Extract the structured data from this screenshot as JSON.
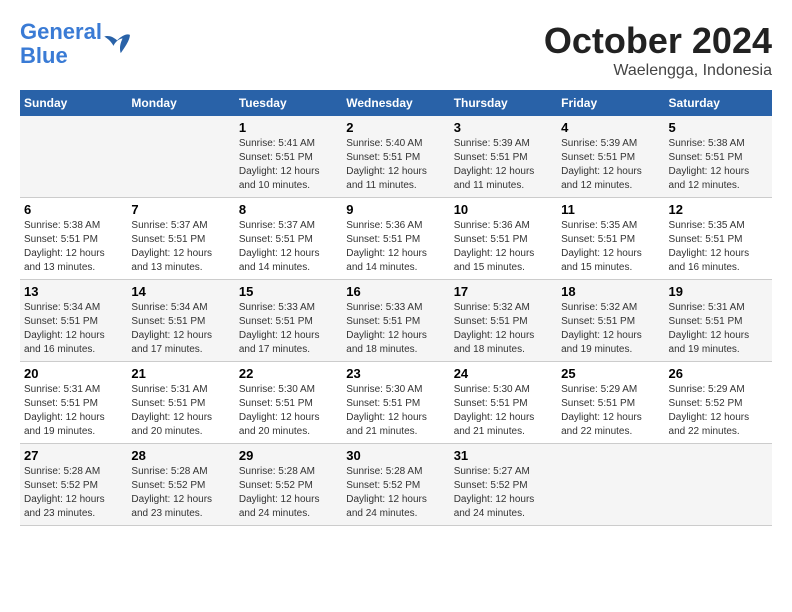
{
  "logo": {
    "line1": "General",
    "line2": "Blue"
  },
  "title": "October 2024",
  "subtitle": "Waelengga, Indonesia",
  "weekdays": [
    "Sunday",
    "Monday",
    "Tuesday",
    "Wednesday",
    "Thursday",
    "Friday",
    "Saturday"
  ],
  "weeks": [
    [
      {
        "day": "",
        "info": ""
      },
      {
        "day": "",
        "info": ""
      },
      {
        "day": "1",
        "info": "Sunrise: 5:41 AM\nSunset: 5:51 PM\nDaylight: 12 hours\nand 10 minutes."
      },
      {
        "day": "2",
        "info": "Sunrise: 5:40 AM\nSunset: 5:51 PM\nDaylight: 12 hours\nand 11 minutes."
      },
      {
        "day": "3",
        "info": "Sunrise: 5:39 AM\nSunset: 5:51 PM\nDaylight: 12 hours\nand 11 minutes."
      },
      {
        "day": "4",
        "info": "Sunrise: 5:39 AM\nSunset: 5:51 PM\nDaylight: 12 hours\nand 12 minutes."
      },
      {
        "day": "5",
        "info": "Sunrise: 5:38 AM\nSunset: 5:51 PM\nDaylight: 12 hours\nand 12 minutes."
      }
    ],
    [
      {
        "day": "6",
        "info": "Sunrise: 5:38 AM\nSunset: 5:51 PM\nDaylight: 12 hours\nand 13 minutes."
      },
      {
        "day": "7",
        "info": "Sunrise: 5:37 AM\nSunset: 5:51 PM\nDaylight: 12 hours\nand 13 minutes."
      },
      {
        "day": "8",
        "info": "Sunrise: 5:37 AM\nSunset: 5:51 PM\nDaylight: 12 hours\nand 14 minutes."
      },
      {
        "day": "9",
        "info": "Sunrise: 5:36 AM\nSunset: 5:51 PM\nDaylight: 12 hours\nand 14 minutes."
      },
      {
        "day": "10",
        "info": "Sunrise: 5:36 AM\nSunset: 5:51 PM\nDaylight: 12 hours\nand 15 minutes."
      },
      {
        "day": "11",
        "info": "Sunrise: 5:35 AM\nSunset: 5:51 PM\nDaylight: 12 hours\nand 15 minutes."
      },
      {
        "day": "12",
        "info": "Sunrise: 5:35 AM\nSunset: 5:51 PM\nDaylight: 12 hours\nand 16 minutes."
      }
    ],
    [
      {
        "day": "13",
        "info": "Sunrise: 5:34 AM\nSunset: 5:51 PM\nDaylight: 12 hours\nand 16 minutes."
      },
      {
        "day": "14",
        "info": "Sunrise: 5:34 AM\nSunset: 5:51 PM\nDaylight: 12 hours\nand 17 minutes."
      },
      {
        "day": "15",
        "info": "Sunrise: 5:33 AM\nSunset: 5:51 PM\nDaylight: 12 hours\nand 17 minutes."
      },
      {
        "day": "16",
        "info": "Sunrise: 5:33 AM\nSunset: 5:51 PM\nDaylight: 12 hours\nand 18 minutes."
      },
      {
        "day": "17",
        "info": "Sunrise: 5:32 AM\nSunset: 5:51 PM\nDaylight: 12 hours\nand 18 minutes."
      },
      {
        "day": "18",
        "info": "Sunrise: 5:32 AM\nSunset: 5:51 PM\nDaylight: 12 hours\nand 19 minutes."
      },
      {
        "day": "19",
        "info": "Sunrise: 5:31 AM\nSunset: 5:51 PM\nDaylight: 12 hours\nand 19 minutes."
      }
    ],
    [
      {
        "day": "20",
        "info": "Sunrise: 5:31 AM\nSunset: 5:51 PM\nDaylight: 12 hours\nand 19 minutes."
      },
      {
        "day": "21",
        "info": "Sunrise: 5:31 AM\nSunset: 5:51 PM\nDaylight: 12 hours\nand 20 minutes."
      },
      {
        "day": "22",
        "info": "Sunrise: 5:30 AM\nSunset: 5:51 PM\nDaylight: 12 hours\nand 20 minutes."
      },
      {
        "day": "23",
        "info": "Sunrise: 5:30 AM\nSunset: 5:51 PM\nDaylight: 12 hours\nand 21 minutes."
      },
      {
        "day": "24",
        "info": "Sunrise: 5:30 AM\nSunset: 5:51 PM\nDaylight: 12 hours\nand 21 minutes."
      },
      {
        "day": "25",
        "info": "Sunrise: 5:29 AM\nSunset: 5:51 PM\nDaylight: 12 hours\nand 22 minutes."
      },
      {
        "day": "26",
        "info": "Sunrise: 5:29 AM\nSunset: 5:52 PM\nDaylight: 12 hours\nand 22 minutes."
      }
    ],
    [
      {
        "day": "27",
        "info": "Sunrise: 5:28 AM\nSunset: 5:52 PM\nDaylight: 12 hours\nand 23 minutes."
      },
      {
        "day": "28",
        "info": "Sunrise: 5:28 AM\nSunset: 5:52 PM\nDaylight: 12 hours\nand 23 minutes."
      },
      {
        "day": "29",
        "info": "Sunrise: 5:28 AM\nSunset: 5:52 PM\nDaylight: 12 hours\nand 24 minutes."
      },
      {
        "day": "30",
        "info": "Sunrise: 5:28 AM\nSunset: 5:52 PM\nDaylight: 12 hours\nand 24 minutes."
      },
      {
        "day": "31",
        "info": "Sunrise: 5:27 AM\nSunset: 5:52 PM\nDaylight: 12 hours\nand 24 minutes."
      },
      {
        "day": "",
        "info": ""
      },
      {
        "day": "",
        "info": ""
      }
    ]
  ]
}
